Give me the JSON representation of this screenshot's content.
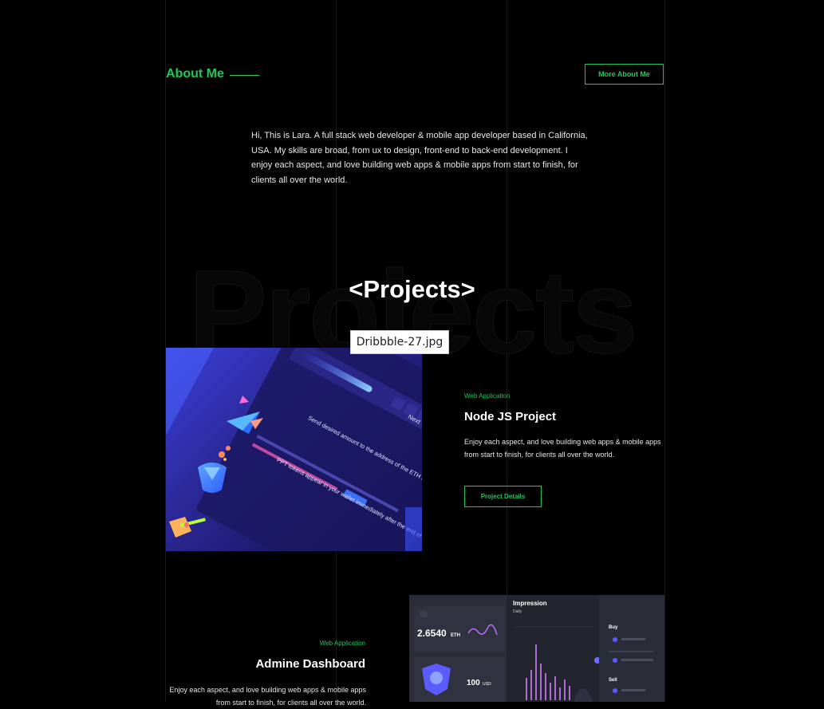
{
  "about": {
    "title": "About Me",
    "button": "More About Me",
    "text": "Hi, This is Lara. A full stack web developer & mobile app developer based in California, USA. My skills are broad, from ux to design, front-end to back-end development. I enjoy each aspect, and love building web apps & mobile apps from start to finish, for clients all over the world."
  },
  "projects": {
    "bg_text": "Projects",
    "title": "<Projects>",
    "tooltip": "Dribbble-27.jpg",
    "items": [
      {
        "tag": "Web Application",
        "title": "Node JS Project",
        "desc": "Enjoy each aspect, and love building web apps & mobile apps from start to finish, for clients all over the world.",
        "button": "Project Details",
        "image_text": {
          "next": "Next",
          "send": "Send desired amount to the address of the ETH contract",
          "tokens": "PPT tokens appear in your wallet immediately after the end of the ICO"
        }
      },
      {
        "tag": "Web Application",
        "title": "Admine Dashboard",
        "desc": "Enjoy each aspect, and love building web apps & mobile apps from start to finish, for clients all over the world.",
        "image_text": {
          "impression": "Impression",
          "daily": "Daily",
          "eth_value": "2.6540",
          "eth_unit": "ETH",
          "usd_value": "100",
          "usd_unit": "USD",
          "buy": "Buy",
          "sell": "Sell"
        }
      }
    ]
  },
  "colors": {
    "accent": "#21c55d",
    "background": "#000000"
  }
}
